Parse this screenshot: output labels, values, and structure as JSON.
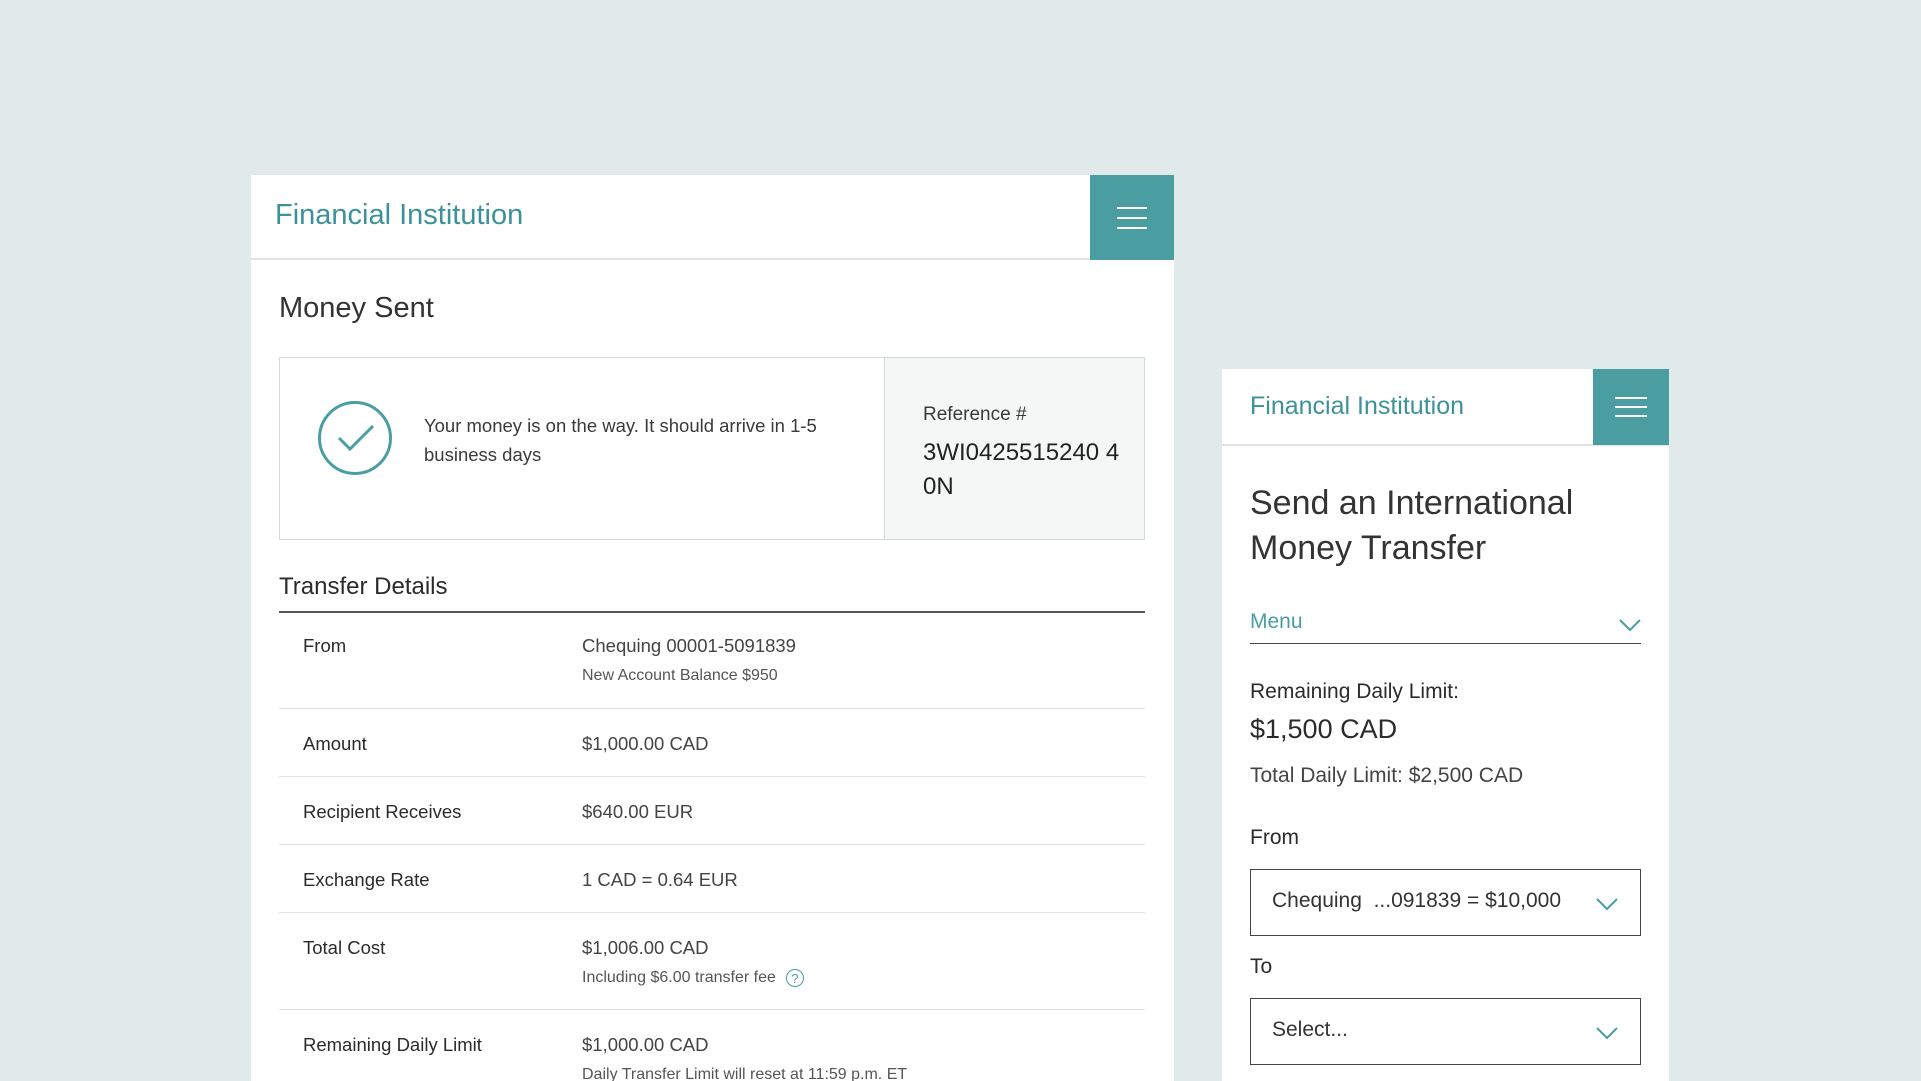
{
  "left": {
    "brand": "Financial Institution",
    "page_title": "Money Sent",
    "confirmation": {
      "message": "Your money is on the way. It should arrive in 1-5 business days",
      "reference_label": "Reference #",
      "reference_value": "3WI0425515240 40N"
    },
    "section_title": "Transfer Details",
    "rows": [
      {
        "label": "From",
        "value": "Chequing 00001-5091839",
        "sub": "New Account Balance $950"
      },
      {
        "label": "Amount",
        "value": "$1,000.00 CAD"
      },
      {
        "label": "Recipient Receives",
        "value": "$640.00 EUR"
      },
      {
        "label": "Exchange Rate",
        "value": "1 CAD = 0.64 EUR"
      },
      {
        "label": "Total Cost",
        "value": "$1,006.00 CAD",
        "sub": "Including $6.00 transfer fee"
      },
      {
        "label": "Remaining Daily Limit",
        "value": "$1,000.00 CAD",
        "sub": "Daily Transfer Limit will reset at 11:59 p.m. ET"
      }
    ],
    "help_glyph": "?"
  },
  "right": {
    "brand": "Financial Institution",
    "page_title": "Send an International Money Transfer",
    "menu_label": "Menu",
    "limit_label": "Remaining Daily Limit:",
    "limit_value": "$1,500 CAD",
    "limit_total": "Total Daily Limit: $2,500 CAD",
    "from_label": "From",
    "from_value": "Chequing  ...091839 = $10,000",
    "to_label": "To",
    "to_value": "Select..."
  },
  "colors": {
    "accent": "#4a9ea2",
    "background": "#e1eaeb"
  },
  "icons": {
    "menu": "hamburger-icon",
    "success": "check-circle-icon",
    "dropdown": "chevron-down-icon",
    "help": "question-circle-icon"
  }
}
